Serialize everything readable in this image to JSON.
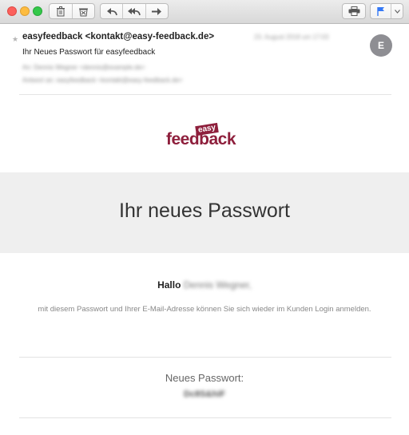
{
  "toolbar": {
    "icons": [
      "trash-icon",
      "junk-icon",
      "reply-icon",
      "reply-all-icon",
      "forward-icon",
      "print-icon",
      "flag-icon",
      "chevron-down-icon"
    ],
    "flag_color": "#3478f6"
  },
  "email": {
    "from": "easyfeedback <kontakt@easy-feedback.de>",
    "subject": "Ihr Neues Passwort für easyfeedback",
    "to_line": "An: Dennis Wegner <dennis@example.de>",
    "reply_to_line": "Antwort an: easyfeedback <kontakt@easy-feedback.de>",
    "date": "23. August 2018 um 17:03",
    "avatar_letter": "E"
  },
  "logo": {
    "easy": "easy",
    "feedback": "feedback",
    "brand_color": "#8e1f3c"
  },
  "content": {
    "heading": "Ihr neues Passwort",
    "greeting": "Hallo",
    "greeting_name": "Dennis Wegner,",
    "body": "mit diesem Passwort und Ihrer E-Mail-Adresse können Sie sich wieder im Kunden Login anmelden.",
    "password_label": "Neues Passwort:",
    "password_value": "Dc8S&hiF"
  }
}
